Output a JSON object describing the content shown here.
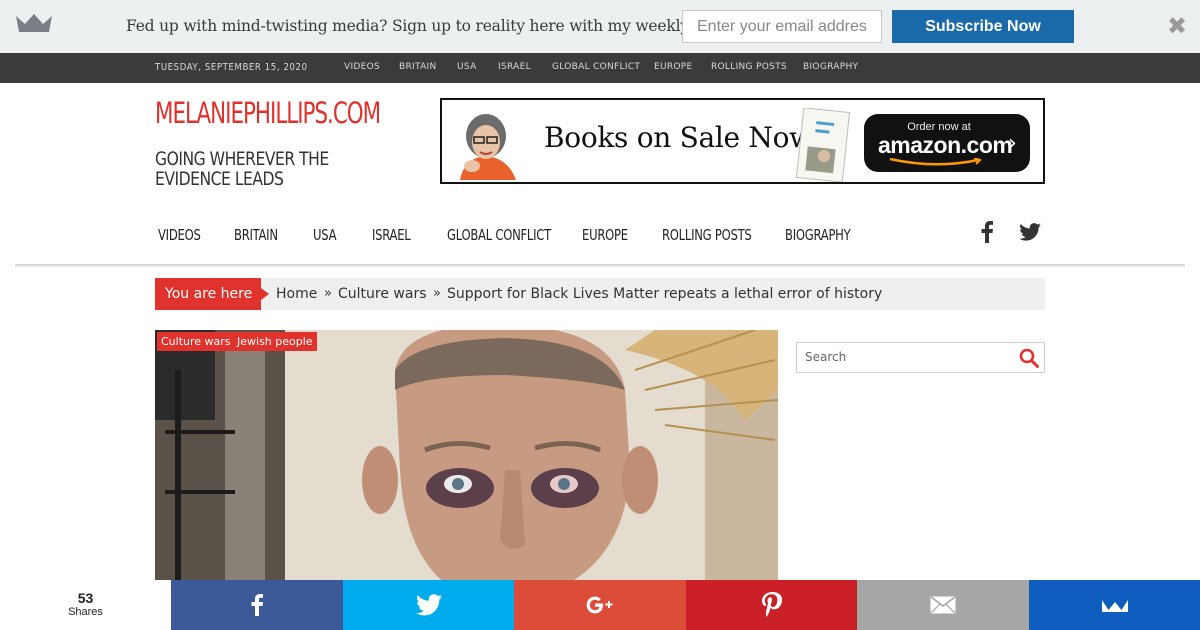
{
  "promo": {
    "text": "Fed up with mind-twisting media? Sign up to reality here with my weekly newsletter",
    "email_placeholder": "Enter your email addres",
    "subscribe_label": "Subscribe Now",
    "close_glyph": "✖"
  },
  "topbar": {
    "date": "TUESDAY, SEPTEMBER 15, 2020",
    "nav": [
      "VIDEOS",
      "BRITAIN",
      "USA",
      "ISRAEL",
      "GLOBAL CONFLICT",
      "EUROPE",
      "ROLLING POSTS",
      "BIOGRAPHY"
    ]
  },
  "header": {
    "title": "MELANIEPHILLIPS.COM",
    "tagline": "GOING WHEREVER THE EVIDENCE LEADS"
  },
  "ad": {
    "headline": "Books on Sale Now",
    "amazon_top": "Order now at",
    "amazon_brand": "amazon.com",
    "amazon_chevron": "›",
    "book_title_small": "GUARDIAN ANGEL"
  },
  "mainnav": {
    "items": [
      "VIDEOS",
      "BRITAIN",
      "USA",
      "ISRAEL",
      "GLOBAL CONFLICT",
      "EUROPE",
      "ROLLING POSTS",
      "BIOGRAPHY"
    ],
    "social_icons": [
      "facebook-icon",
      "twitter-icon"
    ]
  },
  "breadcrumb": {
    "here_label": "You are here",
    "items": [
      "Home",
      "Culture wars",
      "Support for Black Lives Matter repeats a lethal error of history"
    ],
    "separator": "»"
  },
  "article": {
    "tags": [
      "Culture wars",
      "Jewish people"
    ]
  },
  "search": {
    "placeholder": "Search"
  },
  "share": {
    "count": "53",
    "label": "Shares",
    "buttons": [
      {
        "network": "facebook",
        "icon": "facebook-icon",
        "color": "#3b5998"
      },
      {
        "network": "twitter",
        "icon": "twitter-icon",
        "color": "#00aced"
      },
      {
        "network": "google-plus",
        "icon": "google-plus-icon",
        "color": "#dd4b39"
      },
      {
        "network": "pinterest",
        "icon": "pinterest-icon",
        "color": "#cb2027"
      },
      {
        "network": "email",
        "icon": "email-icon",
        "color": "#a6a6a6"
      },
      {
        "network": "sumome",
        "icon": "sumome-icon",
        "color": "#0f5dbf"
      }
    ]
  },
  "colors": {
    "accent_red": "#e2302b",
    "promo_bg": "#ecf0f1",
    "subscribe_blue": "#1a6aaa",
    "topbar_bg": "#3b3b3b"
  }
}
